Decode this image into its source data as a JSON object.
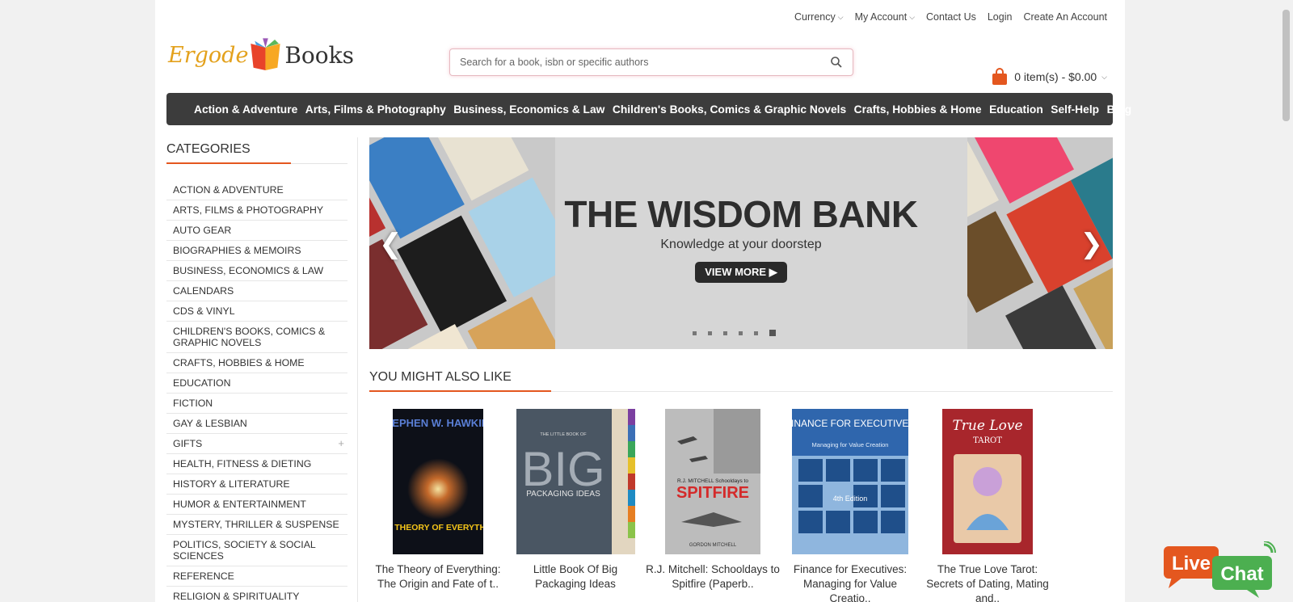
{
  "toplinks": {
    "currency": "Currency",
    "account": "My Account",
    "contact": "Contact Us",
    "login": "Login",
    "create": "Create An Account"
  },
  "logo": {
    "ergode": "Ergode",
    "books": "Books"
  },
  "search": {
    "placeholder": "Search for a book, isbn or specific authors"
  },
  "cart": {
    "label": "0 item(s) - $0.00"
  },
  "nav": [
    "Action & Adventure",
    "Arts, Films & Photography",
    "Business, Economics & Law",
    "Children's Books, Comics & Graphic Novels",
    "Crafts, Hobbies & Home",
    "Education",
    "Self-Help",
    "Blog"
  ],
  "sidebar": {
    "title": "CATEGORIES",
    "items": [
      "ACTION & ADVENTURE",
      "ARTS, FILMS & PHOTOGRAPHY",
      "AUTO GEAR",
      "BIOGRAPHIES & MEMOIRS",
      "BUSINESS, ECONOMICS & LAW",
      "CALENDARS",
      "CDS & VINYL",
      "CHILDREN'S BOOKS, COMICS & GRAPHIC NOVELS",
      "CRAFTS, HOBBIES & HOME",
      "EDUCATION",
      "FICTION",
      "GAY & LESBIAN",
      "GIFTS",
      "HEALTH, FITNESS & DIETING",
      "HISTORY & LITERATURE",
      "HUMOR & ENTERTAINMENT",
      "MYSTERY, THRILLER & SUSPENSE",
      "POLITICS, SOCIETY & SOCIAL SCIENCES",
      "REFERENCE",
      "RELIGION & SPIRITUALITY"
    ]
  },
  "banner": {
    "title": "THE WISDOM BANK",
    "subtitle": "Knowledge at your doorstep",
    "button": "VIEW MORE ▶"
  },
  "section": {
    "title": "YOU MIGHT ALSO LIKE"
  },
  "products": [
    {
      "name": "The Theory of Everything: The Origin and Fate of t..",
      "cover_title": "THE THEORY OF EVERYTHING",
      "cover_author": "STEPHEN W. HAWKING"
    },
    {
      "name": "Little Book Of Big Packaging Ideas",
      "cover_title": "BIG",
      "cover_sub": "PACKAGING IDEAS",
      "cover_top": "THE LITTLE BOOK OF"
    },
    {
      "name": "R.J. Mitchell: Schooldays to Spitfire (Paperb..",
      "cover_title": "SPITFIRE",
      "cover_sub": "R.J. MITCHELL Schooldays to",
      "cover_author": "GORDON MITCHELL"
    },
    {
      "name": "Finance for Executives: Managing for Value Creatio..",
      "cover_title": "FINANCE FOR EXECUTIVES",
      "cover_sub": "Managing for Value Creation",
      "cover_edition": "4th Edition"
    },
    {
      "name": "The True Love Tarot: Secrets of Dating, Mating and..",
      "cover_title": "True Love",
      "cover_sub": "TAROT"
    }
  ],
  "livechat": {
    "live": "Live",
    "chat": "Chat"
  },
  "colors": {
    "accent": "#e4571f",
    "nav_bg": "#3c3c3c"
  }
}
